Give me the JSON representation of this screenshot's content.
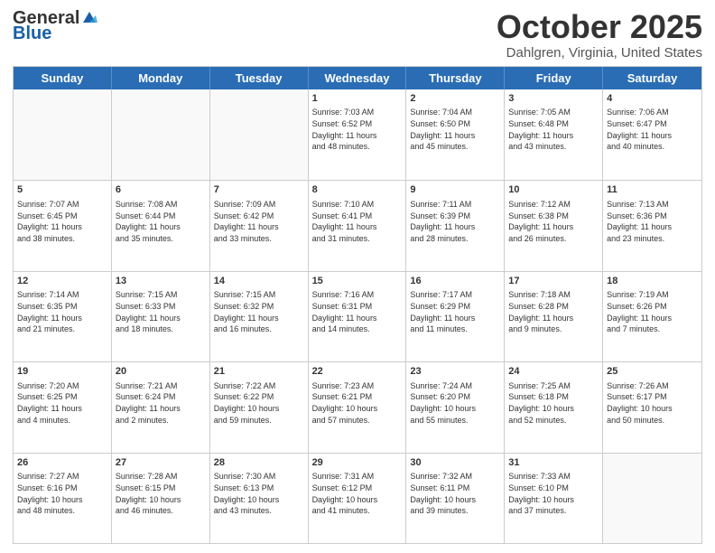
{
  "header": {
    "logo_general": "General",
    "logo_blue": "Blue",
    "month": "October 2025",
    "location": "Dahlgren, Virginia, United States"
  },
  "days_of_week": [
    "Sunday",
    "Monday",
    "Tuesday",
    "Wednesday",
    "Thursday",
    "Friday",
    "Saturday"
  ],
  "weeks": [
    [
      {
        "day": "",
        "info": ""
      },
      {
        "day": "",
        "info": ""
      },
      {
        "day": "",
        "info": ""
      },
      {
        "day": "1",
        "info": "Sunrise: 7:03 AM\nSunset: 6:52 PM\nDaylight: 11 hours\nand 48 minutes."
      },
      {
        "day": "2",
        "info": "Sunrise: 7:04 AM\nSunset: 6:50 PM\nDaylight: 11 hours\nand 45 minutes."
      },
      {
        "day": "3",
        "info": "Sunrise: 7:05 AM\nSunset: 6:48 PM\nDaylight: 11 hours\nand 43 minutes."
      },
      {
        "day": "4",
        "info": "Sunrise: 7:06 AM\nSunset: 6:47 PM\nDaylight: 11 hours\nand 40 minutes."
      }
    ],
    [
      {
        "day": "5",
        "info": "Sunrise: 7:07 AM\nSunset: 6:45 PM\nDaylight: 11 hours\nand 38 minutes."
      },
      {
        "day": "6",
        "info": "Sunrise: 7:08 AM\nSunset: 6:44 PM\nDaylight: 11 hours\nand 35 minutes."
      },
      {
        "day": "7",
        "info": "Sunrise: 7:09 AM\nSunset: 6:42 PM\nDaylight: 11 hours\nand 33 minutes."
      },
      {
        "day": "8",
        "info": "Sunrise: 7:10 AM\nSunset: 6:41 PM\nDaylight: 11 hours\nand 31 minutes."
      },
      {
        "day": "9",
        "info": "Sunrise: 7:11 AM\nSunset: 6:39 PM\nDaylight: 11 hours\nand 28 minutes."
      },
      {
        "day": "10",
        "info": "Sunrise: 7:12 AM\nSunset: 6:38 PM\nDaylight: 11 hours\nand 26 minutes."
      },
      {
        "day": "11",
        "info": "Sunrise: 7:13 AM\nSunset: 6:36 PM\nDaylight: 11 hours\nand 23 minutes."
      }
    ],
    [
      {
        "day": "12",
        "info": "Sunrise: 7:14 AM\nSunset: 6:35 PM\nDaylight: 11 hours\nand 21 minutes."
      },
      {
        "day": "13",
        "info": "Sunrise: 7:15 AM\nSunset: 6:33 PM\nDaylight: 11 hours\nand 18 minutes."
      },
      {
        "day": "14",
        "info": "Sunrise: 7:15 AM\nSunset: 6:32 PM\nDaylight: 11 hours\nand 16 minutes."
      },
      {
        "day": "15",
        "info": "Sunrise: 7:16 AM\nSunset: 6:31 PM\nDaylight: 11 hours\nand 14 minutes."
      },
      {
        "day": "16",
        "info": "Sunrise: 7:17 AM\nSunset: 6:29 PM\nDaylight: 11 hours\nand 11 minutes."
      },
      {
        "day": "17",
        "info": "Sunrise: 7:18 AM\nSunset: 6:28 PM\nDaylight: 11 hours\nand 9 minutes."
      },
      {
        "day": "18",
        "info": "Sunrise: 7:19 AM\nSunset: 6:26 PM\nDaylight: 11 hours\nand 7 minutes."
      }
    ],
    [
      {
        "day": "19",
        "info": "Sunrise: 7:20 AM\nSunset: 6:25 PM\nDaylight: 11 hours\nand 4 minutes."
      },
      {
        "day": "20",
        "info": "Sunrise: 7:21 AM\nSunset: 6:24 PM\nDaylight: 11 hours\nand 2 minutes."
      },
      {
        "day": "21",
        "info": "Sunrise: 7:22 AM\nSunset: 6:22 PM\nDaylight: 10 hours\nand 59 minutes."
      },
      {
        "day": "22",
        "info": "Sunrise: 7:23 AM\nSunset: 6:21 PM\nDaylight: 10 hours\nand 57 minutes."
      },
      {
        "day": "23",
        "info": "Sunrise: 7:24 AM\nSunset: 6:20 PM\nDaylight: 10 hours\nand 55 minutes."
      },
      {
        "day": "24",
        "info": "Sunrise: 7:25 AM\nSunset: 6:18 PM\nDaylight: 10 hours\nand 52 minutes."
      },
      {
        "day": "25",
        "info": "Sunrise: 7:26 AM\nSunset: 6:17 PM\nDaylight: 10 hours\nand 50 minutes."
      }
    ],
    [
      {
        "day": "26",
        "info": "Sunrise: 7:27 AM\nSunset: 6:16 PM\nDaylight: 10 hours\nand 48 minutes."
      },
      {
        "day": "27",
        "info": "Sunrise: 7:28 AM\nSunset: 6:15 PM\nDaylight: 10 hours\nand 46 minutes."
      },
      {
        "day": "28",
        "info": "Sunrise: 7:30 AM\nSunset: 6:13 PM\nDaylight: 10 hours\nand 43 minutes."
      },
      {
        "day": "29",
        "info": "Sunrise: 7:31 AM\nSunset: 6:12 PM\nDaylight: 10 hours\nand 41 minutes."
      },
      {
        "day": "30",
        "info": "Sunrise: 7:32 AM\nSunset: 6:11 PM\nDaylight: 10 hours\nand 39 minutes."
      },
      {
        "day": "31",
        "info": "Sunrise: 7:33 AM\nSunset: 6:10 PM\nDaylight: 10 hours\nand 37 minutes."
      },
      {
        "day": "",
        "info": ""
      }
    ]
  ]
}
